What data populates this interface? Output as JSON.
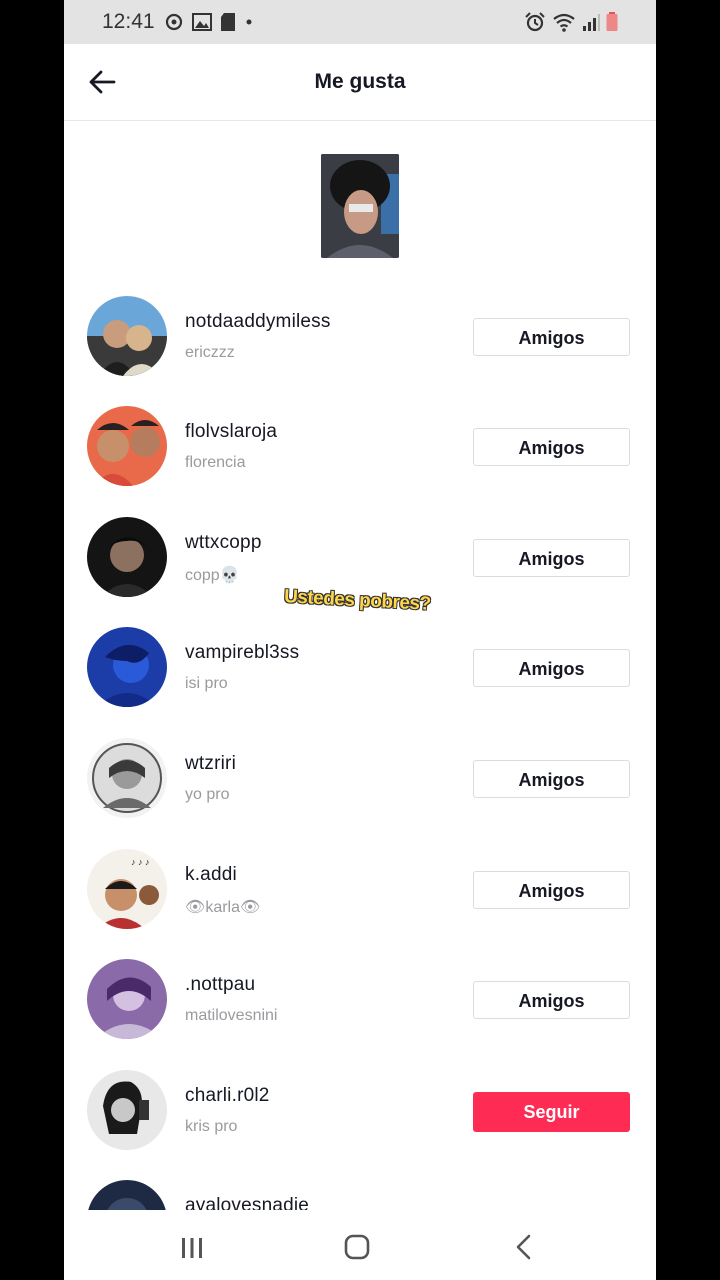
{
  "status_bar": {
    "time": "12:41",
    "left_icons": [
      "sync-icon",
      "gallery-icon",
      "sd-card-icon",
      "dot-icon"
    ],
    "right_icons": [
      "alarm-icon",
      "wifi-icon",
      "signal-icon",
      "battery-low-icon"
    ],
    "battery_color": "#e05555"
  },
  "header": {
    "title": "Me gusta"
  },
  "caption": "Ustedes pobres?",
  "list": {
    "items": [
      {
        "username": "notdaaddymiless",
        "nickname": "ericzzz",
        "button": "Amigos",
        "state": "friends"
      },
      {
        "username": "flolvslaroja",
        "nickname": "florencia",
        "button": "Amigos",
        "state": "friends"
      },
      {
        "username": "wttxcopp",
        "nickname": "copp💀",
        "button": "Amigos",
        "state": "friends"
      },
      {
        "username": "vampirebl3ss",
        "nickname": "isi pro",
        "button": "Amigos",
        "state": "friends"
      },
      {
        "username": "wtzriri",
        "nickname": "yo pro",
        "button": "Amigos",
        "state": "friends"
      },
      {
        "username": "k.addi",
        "nickname": "👁karla👁",
        "button": "Amigos",
        "state": "friends"
      },
      {
        "username": ".nottpau",
        "nickname": "matilovesnini",
        "button": "Amigos",
        "state": "friends"
      },
      {
        "username": "charli.r0l2",
        "nickname": "kris pro",
        "button": "Seguir",
        "state": "follow"
      },
      {
        "username": "ayalovesnadie",
        "nickname": "",
        "button": "",
        "state": "friends"
      }
    ]
  },
  "colors": {
    "follow_button": "#fe2c55",
    "caption": "#ffd54a"
  },
  "nav_bar": {
    "icons": [
      "recents-icon",
      "home-icon",
      "back-icon"
    ]
  }
}
